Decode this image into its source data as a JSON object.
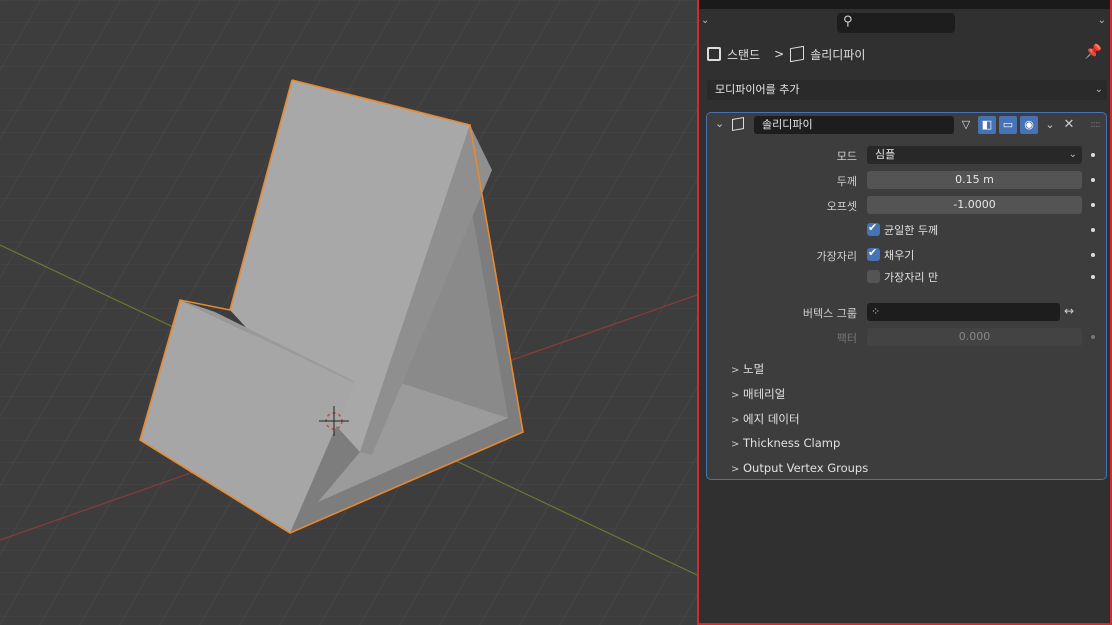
{
  "header": {
    "search_icon": "search-icon",
    "breadcrumb": {
      "object_name": "스탠드",
      "separator": ">",
      "modifier_name": "솔리디파이"
    },
    "pin_icon": "pin-icon"
  },
  "add_modifier": {
    "label": "모디파이어를 추가",
    "arrow": "⌄"
  },
  "modifier": {
    "name": "솔리디파이",
    "expand": "⌄",
    "close": "✕",
    "menu": "⌄",
    "drag": "::::",
    "mode": {
      "label": "모드",
      "value": "심플"
    },
    "thickness": {
      "label": "두께",
      "value": "0.15 m"
    },
    "offset": {
      "label": "오프셋",
      "value": "-1.0000"
    },
    "even_thickness": {
      "label": "균일한 두께",
      "checked": true
    },
    "rim": {
      "label": "가장자리",
      "fill": {
        "label": "채우기",
        "checked": true
      },
      "only_rim": {
        "label": "가장자리 만",
        "checked": false
      }
    },
    "vertex_group": {
      "label": "버텍스 그룹",
      "value": ""
    },
    "factor": {
      "label": "팩터",
      "value": "0.000"
    },
    "subpanels": [
      {
        "chev": ">",
        "label": "노멀"
      },
      {
        "chev": ">",
        "label": "매테리얼"
      },
      {
        "chev": ">",
        "label": "에지 데이터"
      },
      {
        "chev": ">",
        "label": "Thickness Clamp"
      },
      {
        "chev": ">",
        "label": "Output Vertex Groups"
      }
    ]
  },
  "colors": {
    "accent": "#4772b3",
    "selection_outline": "#e8892f",
    "panel_border": "#d42a2a",
    "viewport_bg": "#3d3d3d"
  }
}
